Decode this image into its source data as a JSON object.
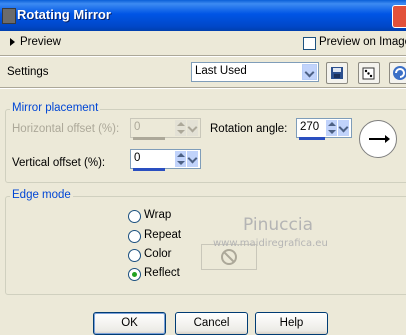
{
  "window": {
    "title": "Rotating Mirror"
  },
  "preview": {
    "label": "Preview",
    "on_image_label": "Preview on Image",
    "on_image_checked": false
  },
  "settings": {
    "label": "Settings",
    "preset_value": "Last Used",
    "icons": [
      "save-preset-icon",
      "randomize-icon",
      "reset-icon"
    ]
  },
  "mirror_placement": {
    "title": "Mirror placement",
    "horizontal_offset_label": "Horizontal offset (%):",
    "horizontal_offset_value": "0",
    "horizontal_offset_enabled": false,
    "vertical_offset_label": "Vertical offset (%):",
    "vertical_offset_value": "0",
    "rotation_angle_label": "Rotation angle:",
    "rotation_angle_value": "270"
  },
  "edge_mode": {
    "title": "Edge mode",
    "options": [
      "Wrap",
      "Repeat",
      "Color",
      "Reflect"
    ],
    "selected": "Reflect"
  },
  "watermark": {
    "name": "Pinuccia",
    "url": "www.maidiregrafica.eu"
  },
  "buttons": {
    "ok": "OK",
    "cancel": "Cancel",
    "help": "Help"
  },
  "colors": {
    "accent": "#0046d5",
    "titlebar": "#0055e5",
    "face": "#ece9d8"
  }
}
